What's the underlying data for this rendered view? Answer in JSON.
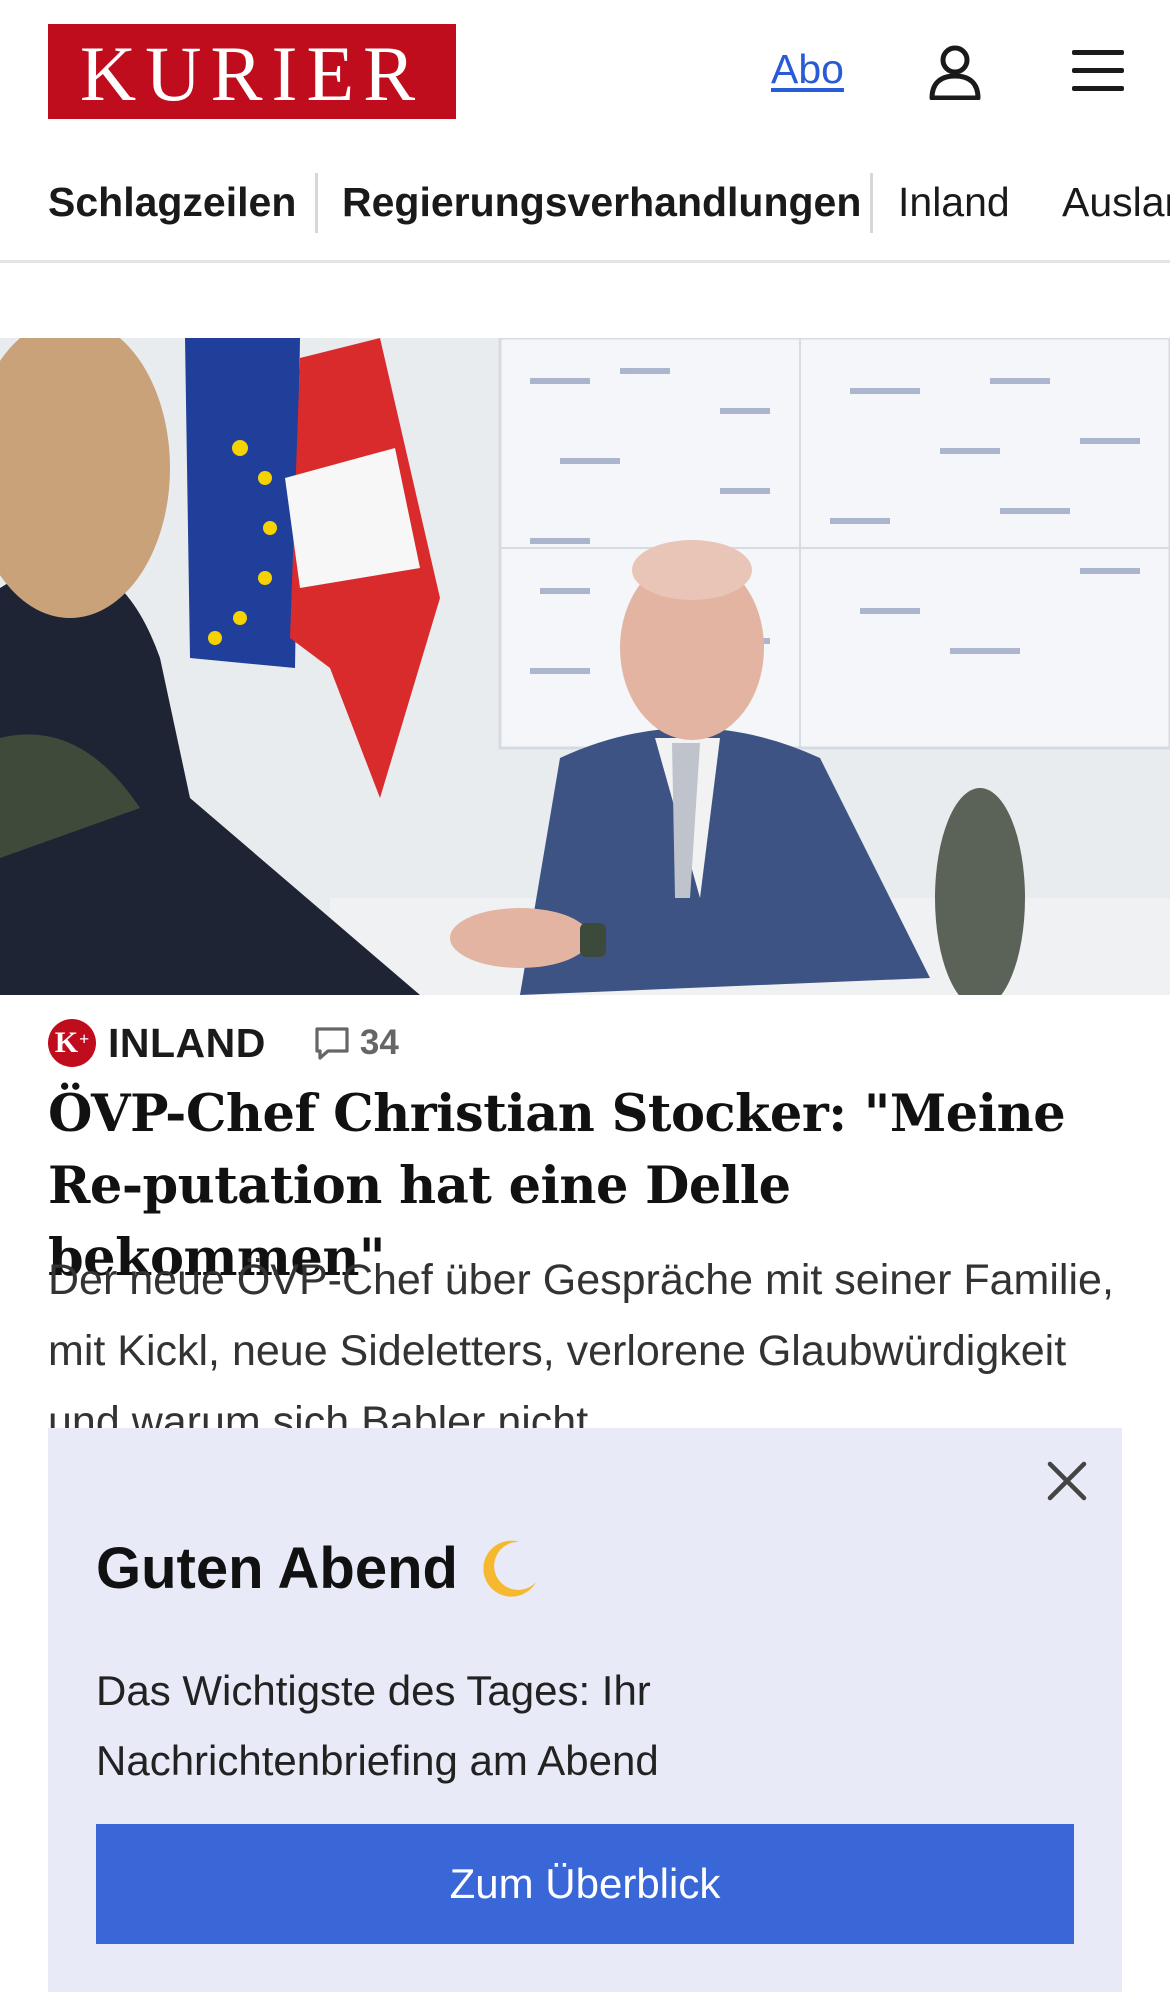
{
  "header": {
    "logo_text": "KURIER",
    "abo_label": "Abo",
    "user_icon": "user-icon",
    "menu_icon": "menu-icon"
  },
  "nav": {
    "items": [
      {
        "label": "Schlagzeilen"
      },
      {
        "label": "Regierungsverhandlungen"
      },
      {
        "label": "Inland"
      },
      {
        "label": "Ausland"
      }
    ]
  },
  "article": {
    "badge_text": "K",
    "badge_plus": "+",
    "category": "INLAND",
    "comment_count": "34",
    "headline": "ÖVP-Chef Christian Stocker: \"Meine Re-putation hat eine Delle bekommen\"",
    "teaser": "Der neue ÖVP-Chef über Gespräche mit seiner Familie, mit Kickl, neue Sideletters, verlorene Glaubwürdigkeit und warum sich Babler nicht"
  },
  "popup": {
    "title": "Guten Abend",
    "icon": "crescent-moon-icon",
    "text": "Das Wichtigste des Tages: Ihr Nachrichtenbriefing am Abend",
    "cta_label": "Zum Überblick"
  },
  "colors": {
    "brand_red": "#c00d1e",
    "link_blue": "#2a5bd7",
    "popup_bg": "#e8ebf7",
    "cta_blue": "#3a67d8"
  }
}
